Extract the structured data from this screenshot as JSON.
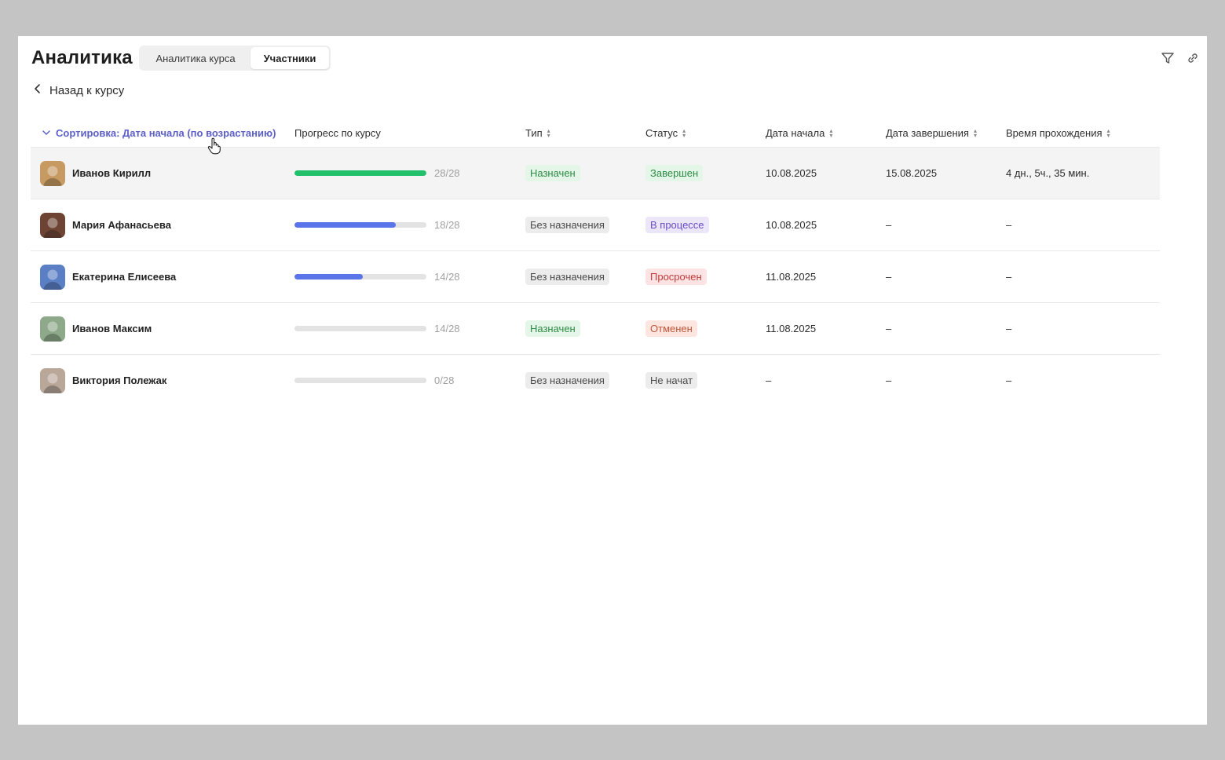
{
  "page": {
    "title": "Аналитика",
    "tabs": [
      {
        "label": "Аналитика курса",
        "active": false
      },
      {
        "label": "Участники",
        "active": true
      }
    ],
    "back_label": "Назад к курсу",
    "icons": [
      "filter-icon",
      "link-icon"
    ]
  },
  "table": {
    "sort_label": "Сортировка: Дата начала (по возрастанию)",
    "headers": {
      "progress": "Прогресс по курсу",
      "type": "Тип",
      "status": "Статус",
      "start": "Дата начала",
      "end": "Дата завершения",
      "time": "Время прохождения"
    },
    "rows": [
      {
        "name": "Иванов Кирилл",
        "progress_fraction": 1.0,
        "progress_color": "#22c06b",
        "progress_text": "28/28",
        "type": "Назначен",
        "type_bg": "#e3f6e7",
        "type_fg": "#2f8a46",
        "status": "Завершен",
        "status_bg": "#e3f6e7",
        "status_fg": "#2f8a46",
        "start": "10.08.2025",
        "end": "15.08.2025",
        "time": "4 дн., 5ч., 35 мин.",
        "avatar_color": "#c79a62",
        "highlighted": true
      },
      {
        "name": "Мария Афанасьева",
        "progress_fraction": 0.77,
        "progress_color": "#5a74ea",
        "progress_text": "18/28",
        "type": "Без назначения",
        "type_bg": "#ececec",
        "type_fg": "#4a4a4a",
        "status": "В процессе",
        "status_bg": "#ece6fb",
        "status_fg": "#6a4bc4",
        "start": "10.08.2025",
        "end": "–",
        "time": "–",
        "avatar_color": "#6d4434",
        "highlighted": false
      },
      {
        "name": "Екатерина Елисеева",
        "progress_fraction": 0.52,
        "progress_color": "#5a74ea",
        "progress_text": "14/28",
        "type": "Без назначения",
        "type_bg": "#ececec",
        "type_fg": "#4a4a4a",
        "status": "Просрочен",
        "status_bg": "#fde3e3",
        "status_fg": "#c13a3a",
        "start": "11.08.2025",
        "end": "–",
        "time": "–",
        "avatar_color": "#5a7fc4",
        "highlighted": false
      },
      {
        "name": "Иванов Максим",
        "progress_fraction": 0.0,
        "progress_color": "#5a74ea",
        "progress_text": "14/28",
        "type": "Назначен",
        "type_bg": "#e3f6e7",
        "type_fg": "#2f8a46",
        "status": "Отменен",
        "status_bg": "#fde6df",
        "status_fg": "#c0573a",
        "start": "11.08.2025",
        "end": "–",
        "time": "–",
        "avatar_color": "#8ea88a",
        "highlighted": false
      },
      {
        "name": "Виктория Полежак",
        "progress_fraction": 0.0,
        "progress_color": "#5a74ea",
        "progress_text": "0/28",
        "type": "Без назначения",
        "type_bg": "#ececec",
        "type_fg": "#4a4a4a",
        "status": "Не начат",
        "status_bg": "#ececec",
        "status_fg": "#4a4a4a",
        "start": "–",
        "end": "–",
        "time": "–",
        "avatar_color": "#b9a79a",
        "highlighted": false
      }
    ]
  },
  "colors": {
    "accent": "#5b5fc7",
    "progress_done": "#22c06b",
    "progress_active": "#5a74ea",
    "track": "#e3e3e3"
  }
}
